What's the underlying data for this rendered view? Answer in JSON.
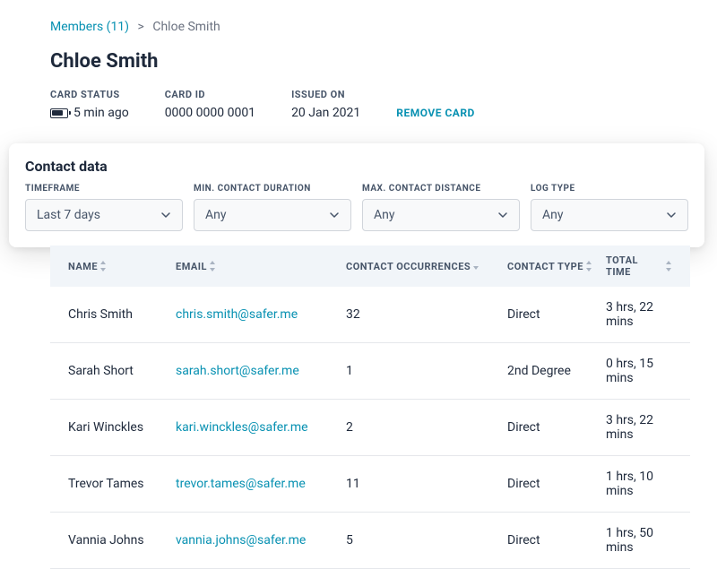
{
  "breadcrumb": {
    "members_label": "Members (11)",
    "current": "Chloe Smith"
  },
  "page_title": "Chloe Smith",
  "meta": {
    "card_status_label": "CARD STATUS",
    "card_status_value": "5 min ago",
    "card_id_label": "CARD ID",
    "card_id_value": "0000 0000 0001",
    "issued_label": "ISSUED ON",
    "issued_value": "20 Jan 2021",
    "remove_label": "REMOVE CARD"
  },
  "panel": {
    "title": "Contact data",
    "filters": {
      "timeframe_label": "TIMEFRAME",
      "timeframe_value": "Last 7 days",
      "min_duration_label": "MIN. CONTACT DURATION",
      "min_duration_value": "Any",
      "max_distance_label": "MAX. CONTACT DISTANCE",
      "max_distance_value": "Any",
      "log_type_label": "LOG TYPE",
      "log_type_value": "Any"
    }
  },
  "table": {
    "headers": {
      "name": "NAME",
      "email": "EMAIL",
      "occurrences": "CONTACT OCCURRENCES",
      "type": "CONTACT TYPE",
      "time": "TOTAL TIME"
    },
    "rows": [
      {
        "name": "Chris Smith",
        "email": "chris.smith@safer.me",
        "occurrences": "32",
        "type": "Direct",
        "time": "3 hrs, 22 mins"
      },
      {
        "name": "Sarah Short",
        "email": "sarah.short@safer.me",
        "occurrences": "1",
        "type": "2nd Degree",
        "time": "0 hrs, 15 mins"
      },
      {
        "name": "Kari Winckles",
        "email": "kari.winckles@safer.me",
        "occurrences": "2",
        "type": "Direct",
        "time": "3 hrs, 22 mins"
      },
      {
        "name": "Trevor Tames",
        "email": "trevor.tames@safer.me",
        "occurrences": "11",
        "type": "Direct",
        "time": "1 hrs, 10 mins"
      },
      {
        "name": "Vannia Johns",
        "email": "vannia.johns@safer.me",
        "occurrences": "5",
        "type": "Direct",
        "time": "1 hrs, 50 mins"
      }
    ]
  }
}
